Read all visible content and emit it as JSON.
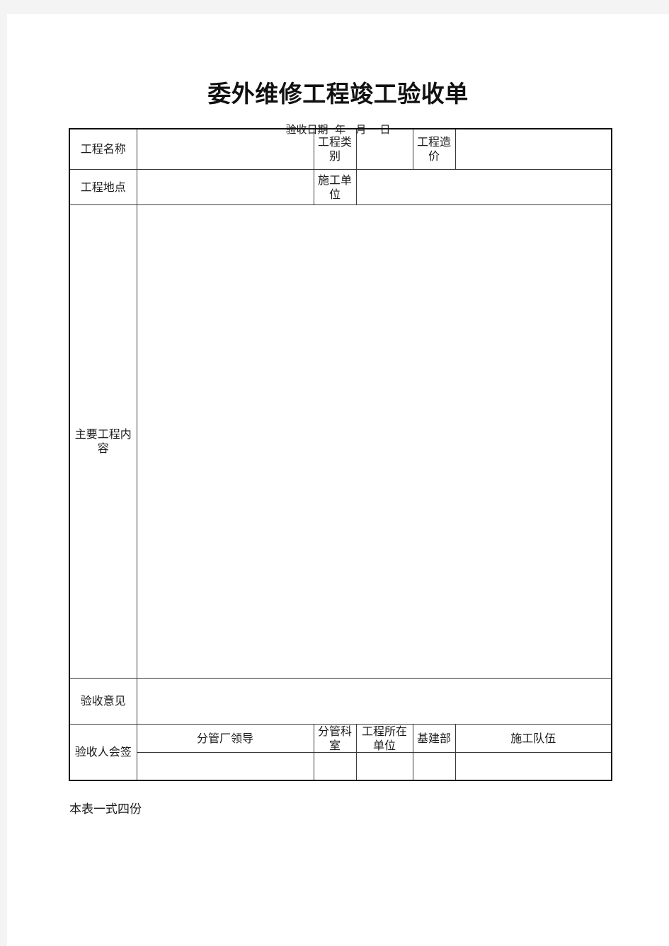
{
  "document": {
    "title": "委外维修工程竣工验收单",
    "date_line": "验收日期  年   月    日",
    "footer_note": "本表一式四份"
  },
  "table": {
    "row_project_name": {
      "label_name": "工程名称",
      "value_name": "",
      "label_category": "工程类别",
      "value_category": "",
      "label_cost": "工程造价",
      "value_cost": ""
    },
    "row_project_location": {
      "label_location": "工程地点",
      "value_location": "",
      "label_contractor": "施工单位",
      "value_contractor": ""
    },
    "row_main_content": {
      "label": "主要工程内容",
      "value": ""
    },
    "row_opinion": {
      "label": "验收意见",
      "value": ""
    },
    "row_signatures": {
      "label": "验收人会签",
      "columns": [
        "分管厂领导",
        "分管科室",
        "工程所在单位",
        "基建部",
        "施工队伍"
      ],
      "values": [
        "",
        "",
        "",
        "",
        ""
      ]
    }
  },
  "colors": {
    "page_background": "#ffffff",
    "canvas_background": "#f4f4f4",
    "text": "#1a1a1a",
    "border_outer": "#111111",
    "border_inner": "#3a3a3a"
  }
}
